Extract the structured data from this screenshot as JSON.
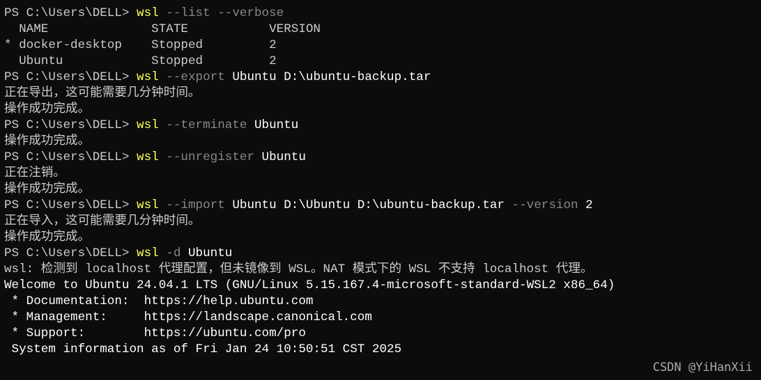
{
  "lines": {
    "l1": {
      "prompt": "PS C:\\Users\\DELL> ",
      "cmd": "wsl",
      "flag": " --list --verbose"
    },
    "l2": "  NAME              STATE           VERSION",
    "l3": "* docker-desktop    Stopped         2",
    "l4": "  Ubuntu            Stopped         2",
    "l5": {
      "prompt": "PS C:\\Users\\DELL> ",
      "cmd": "wsl",
      "flag": " --export",
      "arg": " Ubuntu D:\\ubuntu-backup.tar"
    },
    "l6": "正在导出，这可能需要几分钟时间。",
    "l7": "操作成功完成。",
    "l8": {
      "prompt": "PS C:\\Users\\DELL> ",
      "cmd": "wsl",
      "flag": " --terminate",
      "arg": " Ubuntu"
    },
    "l9": "操作成功完成。",
    "l10": {
      "prompt": "PS C:\\Users\\DELL> ",
      "cmd": "wsl",
      "flag": " --unregister",
      "arg": " Ubuntu"
    },
    "l11": "正在注销。",
    "l12": "操作成功完成。",
    "l13": {
      "prompt": "PS C:\\Users\\DELL> ",
      "cmd": "wsl",
      "flag": " --import",
      "arg": " Ubuntu D:\\Ubuntu D:\\ubuntu-backup.tar ",
      "flag2": "--version",
      "arg2": " 2"
    },
    "l14": "正在导入，这可能需要几分钟时间。",
    "l15": "操作成功完成。",
    "l16": {
      "prompt": "PS C:\\Users\\DELL> ",
      "cmd": "wsl",
      "flag": " -d",
      "arg": " Ubuntu"
    },
    "l17": "wsl: 检测到 localhost 代理配置，但未镜像到 WSL。NAT 模式下的 WSL 不支持 localhost 代理。",
    "l18": "Welcome to Ubuntu 24.04.1 LTS (GNU/Linux 5.15.167.4-microsoft-standard-WSL2 x86_64)",
    "l19": "",
    "l20": " * Documentation:  https://help.ubuntu.com",
    "l21": " * Management:     https://landscape.canonical.com",
    "l22": " * Support:        https://ubuntu.com/pro",
    "l23": "",
    "l24": " System information as of Fri Jan 24 10:50:51 CST 2025"
  },
  "watermark": "CSDN @YiHanXii"
}
